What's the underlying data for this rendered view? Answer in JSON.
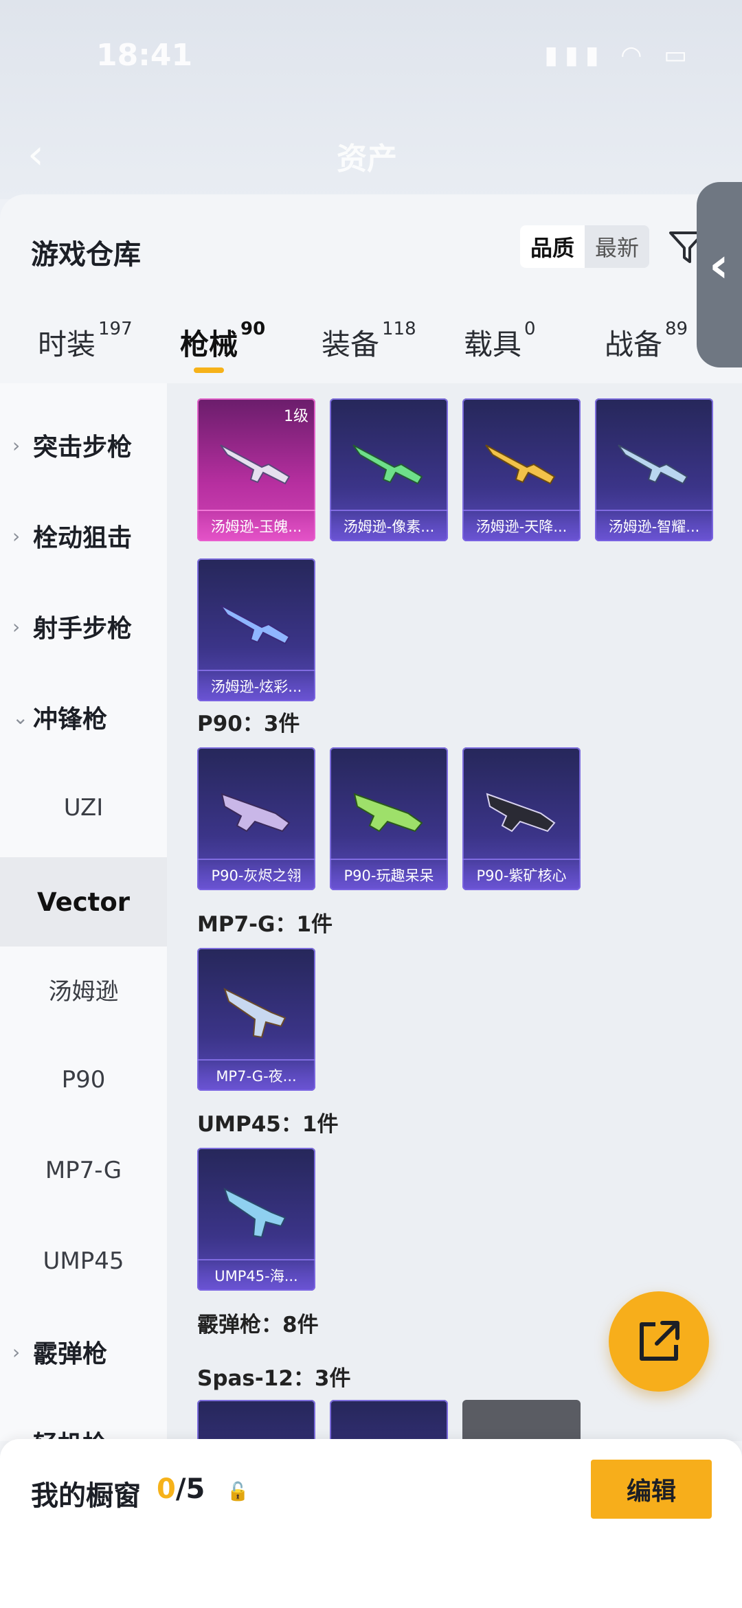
{
  "status": {
    "time": "18:41"
  },
  "header": {
    "title": "资产"
  },
  "sheet": {
    "title": "游戏仓库",
    "sort": {
      "quality": "品质",
      "newest": "最新"
    }
  },
  "tabs": [
    {
      "label": "时装",
      "count": "197"
    },
    {
      "label": "枪械",
      "count": "90"
    },
    {
      "label": "装备",
      "count": "118"
    },
    {
      "label": "载具",
      "count": "0"
    },
    {
      "label": "战备",
      "count": "89"
    }
  ],
  "sidebar": {
    "items": [
      {
        "label": "突击步枪"
      },
      {
        "label": "栓动狙击"
      },
      {
        "label": "射手步枪"
      },
      {
        "label": "冲锋枪"
      },
      {
        "label": "UZI"
      },
      {
        "label": "Vector"
      },
      {
        "label": "汤姆逊"
      },
      {
        "label": "P90"
      },
      {
        "label": "MP7-G"
      },
      {
        "label": "UMP45"
      },
      {
        "label": "霰弹枪"
      },
      {
        "label": "轻机枪"
      }
    ]
  },
  "content": {
    "tommy": [
      {
        "label": "汤姆逊-玉魄...",
        "level": "1级"
      },
      {
        "label": "汤姆逊-像素..."
      },
      {
        "label": "汤姆逊-天降..."
      },
      {
        "label": "汤姆逊-智耀..."
      },
      {
        "label": "汤姆逊-炫彩..."
      }
    ],
    "p90_title": "P90：3件",
    "p90": [
      {
        "label": "P90-灰烬之翎"
      },
      {
        "label": "P90-玩趣呆呆"
      },
      {
        "label": "P90-紫矿核心"
      }
    ],
    "mp7_title": "MP7-G：1件",
    "mp7": [
      {
        "label": "MP7-G-夜..."
      }
    ],
    "ump_title": "UMP45：1件",
    "ump": [
      {
        "label": "UMP45-海..."
      }
    ],
    "shotgun_title": "霰弹枪：8件",
    "spas_title": "Spas-12：3件"
  },
  "bottom": {
    "title": "我的橱窗",
    "count_current": "0",
    "count_total": "/5",
    "edit": "编辑"
  },
  "colors": {
    "accent": "#f6b21a",
    "card_purple": "#3b3488",
    "card_pink": "#b72fa0"
  }
}
